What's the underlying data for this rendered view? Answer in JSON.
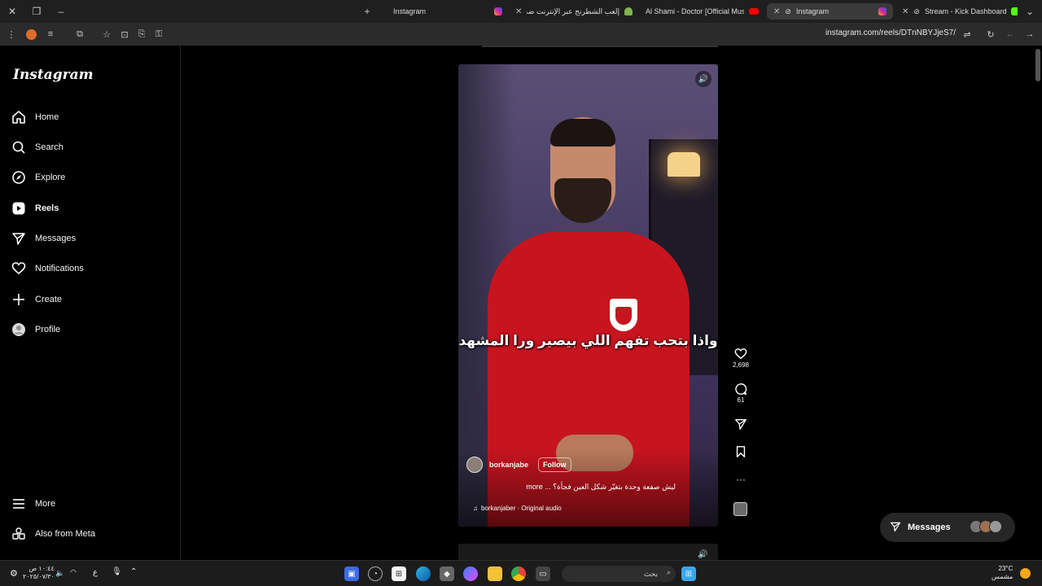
{
  "browser": {
    "tabs": [
      {
        "title": "Instagram",
        "active": false,
        "favicon_color": "#d6249f"
      },
      {
        "title": "إلعب الشطرنج عبر الإنترنت ضد ک",
        "active": false,
        "favicon_color": "#81b64c"
      },
      {
        "title": "Al Shami - Doctor [Official Mus",
        "active": false,
        "favicon_color": "#ff0000"
      },
      {
        "title": "Instagram",
        "active": true,
        "favicon_color": "#d6249f"
      },
      {
        "title": "Stream - Kick Dashboard",
        "active": false,
        "favicon_color": "#53fc18"
      }
    ],
    "url": "instagram.com/reels/DTnNBYJjeS7/"
  },
  "sidebar": {
    "logo": "Instagram",
    "items": [
      {
        "label": "Home",
        "icon": "home-icon"
      },
      {
        "label": "Search",
        "icon": "search-icon"
      },
      {
        "label": "Explore",
        "icon": "compass-icon"
      },
      {
        "label": "Reels",
        "icon": "reels-icon",
        "active": true
      },
      {
        "label": "Messages",
        "icon": "paper-plane-icon"
      },
      {
        "label": "Notifications",
        "icon": "heart-icon"
      },
      {
        "label": "Create",
        "icon": "plus-icon"
      },
      {
        "label": "Profile",
        "icon": "profile-avatar-icon"
      }
    ],
    "more": "More",
    "meta": "Also from Meta"
  },
  "reel": {
    "caption_overlay": "واذا بتحب تفهم اللي بيصير ورا المشهد",
    "username": "borkanjabe",
    "follow_label": "Follow",
    "description": "ليش صفعة وحدة بتغيّر شكل العين فجأة؟ ... more",
    "audio": "borkanjaber · Original audio",
    "likes": "2,698",
    "comments": "61"
  },
  "messages_pill": {
    "label": "Messages"
  },
  "taskbar": {
    "time": "١٠:٤٤ ص",
    "date": "٢٠٢٥/٠٧/٣٠",
    "lang": "ع",
    "search_placeholder": "بحث",
    "weather_temp": "23°C",
    "weather_desc": "مشمس"
  },
  "colors": {
    "accent": "#0095f6",
    "jersey_red": "#c7141f",
    "background": "#000000"
  }
}
